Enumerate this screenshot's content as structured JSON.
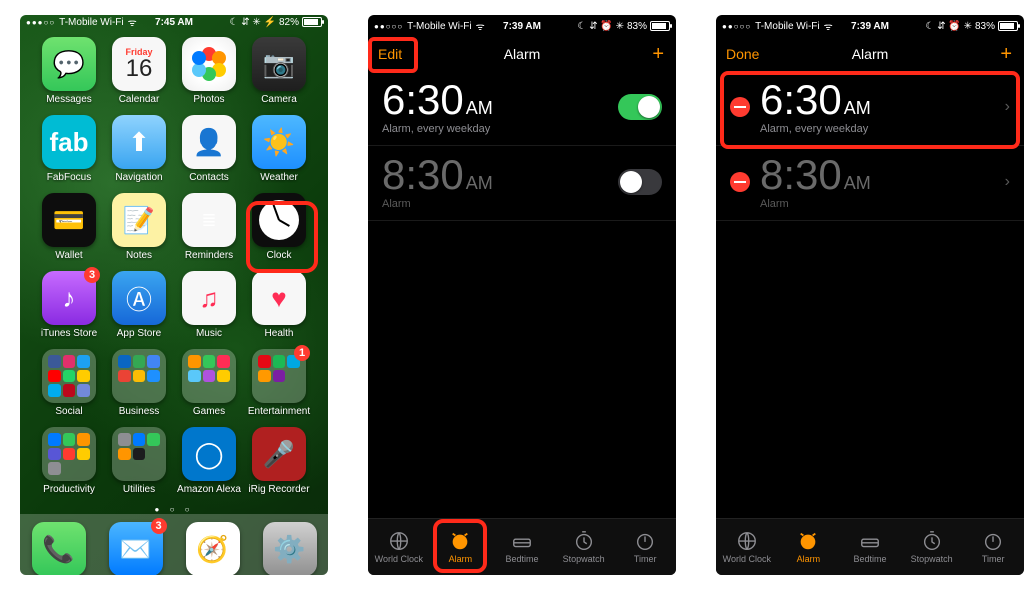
{
  "home": {
    "status": {
      "carrier": "T-Mobile Wi-Fi",
      "signal": "●●●○○",
      "time": "7:45 AM",
      "battery": "82%",
      "icons": "☾ ⇵ ✳ ⚡"
    },
    "calendar_day": "Friday",
    "calendar_date": "16",
    "apps": {
      "messages": "Messages",
      "calendar": "Calendar",
      "photos": "Photos",
      "camera": "Camera",
      "fabfocus": "FabFocus",
      "navigation": "Navigation",
      "contacts": "Contacts",
      "weather": "Weather",
      "wallet": "Wallet",
      "notes": "Notes",
      "reminders": "Reminders",
      "clock": "Clock",
      "itunes": "iTunes Store",
      "appstore": "App Store",
      "music": "Music",
      "health": "Health",
      "social": "Social",
      "business": "Business",
      "games": "Games",
      "entertainment": "Entertainment",
      "productivity": "Productivity",
      "utilities": "Utilities",
      "alexa": "Amazon Alexa",
      "irig": "iRig Recorder",
      "phone": "Phone",
      "mail": "Mail",
      "safari": "Safari",
      "settings": "Settings"
    },
    "badges": {
      "itunes": "3",
      "entertainment": "1",
      "mail": "3"
    },
    "fab_label": "fab"
  },
  "alarm1": {
    "status": {
      "carrier": "T-Mobile Wi-Fi",
      "signal": "●●○○○",
      "time": "7:39 AM",
      "battery": "83%",
      "icons": "☾ ⇵ ⏰ ✳"
    },
    "edit": "Edit",
    "title": "Alarm",
    "add": "+",
    "rows": [
      {
        "time": "6:30",
        "ampm": "AM",
        "sub": "Alarm, every weekday",
        "on": true
      },
      {
        "time": "8:30",
        "ampm": "AM",
        "sub": "Alarm",
        "on": false
      }
    ],
    "tabs": {
      "world": "World Clock",
      "alarm": "Alarm",
      "bedtime": "Bedtime",
      "stopwatch": "Stopwatch",
      "timer": "Timer"
    }
  },
  "alarm2": {
    "status": {
      "carrier": "T-Mobile Wi-Fi",
      "signal": "●●○○○",
      "time": "7:39 AM",
      "battery": "83%",
      "icons": "☾ ⇵ ⏰ ✳"
    },
    "done": "Done",
    "title": "Alarm",
    "add": "+",
    "rows": [
      {
        "time": "6:30",
        "ampm": "AM",
        "sub": "Alarm, every weekday"
      },
      {
        "time": "8:30",
        "ampm": "AM",
        "sub": "Alarm"
      }
    ],
    "tabs": {
      "world": "World Clock",
      "alarm": "Alarm",
      "bedtime": "Bedtime",
      "stopwatch": "Stopwatch",
      "timer": "Timer"
    }
  }
}
